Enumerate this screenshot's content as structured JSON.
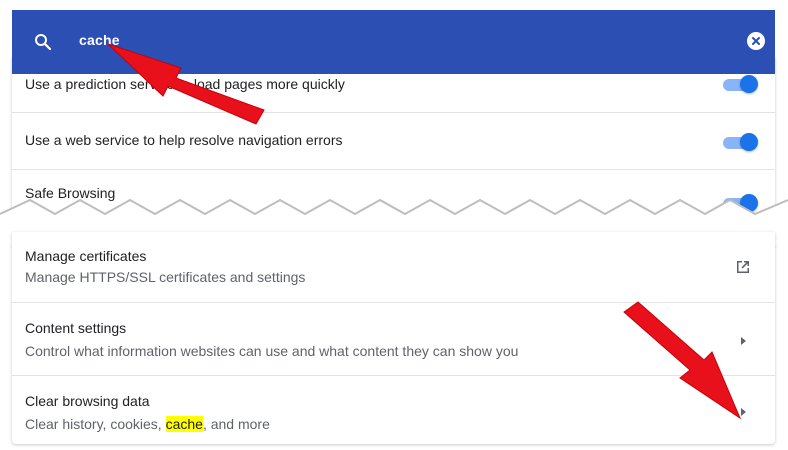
{
  "search": {
    "query": "cache",
    "icon": "search-icon",
    "clear_icon": "clear-search-icon",
    "bar_color": "#2c4fb4"
  },
  "settings_top": [
    {
      "title": "Use a prediction service to load pages more quickly",
      "toggle": true
    },
    {
      "title": "Use a web service to help resolve navigation errors",
      "toggle": true
    },
    {
      "title": "Safe Browsing",
      "toggle": true
    }
  ],
  "settings_bottom": {
    "certificates": {
      "title": "Manage certificates",
      "subtitle": "Manage HTTPS/SSL certificates and settings",
      "icon": "open-external-icon"
    },
    "content": {
      "title": "Content settings",
      "subtitle": "Control what information websites can use and what content they can show you"
    },
    "clear": {
      "title": "Clear browsing data",
      "subtitle_before": "Clear history, cookies, ",
      "subtitle_highlight": "cache",
      "subtitle_after": ", and more"
    }
  },
  "colors": {
    "accent": "#1a73e8",
    "arrow": "#e8101a",
    "highlight": "#ffff00"
  }
}
